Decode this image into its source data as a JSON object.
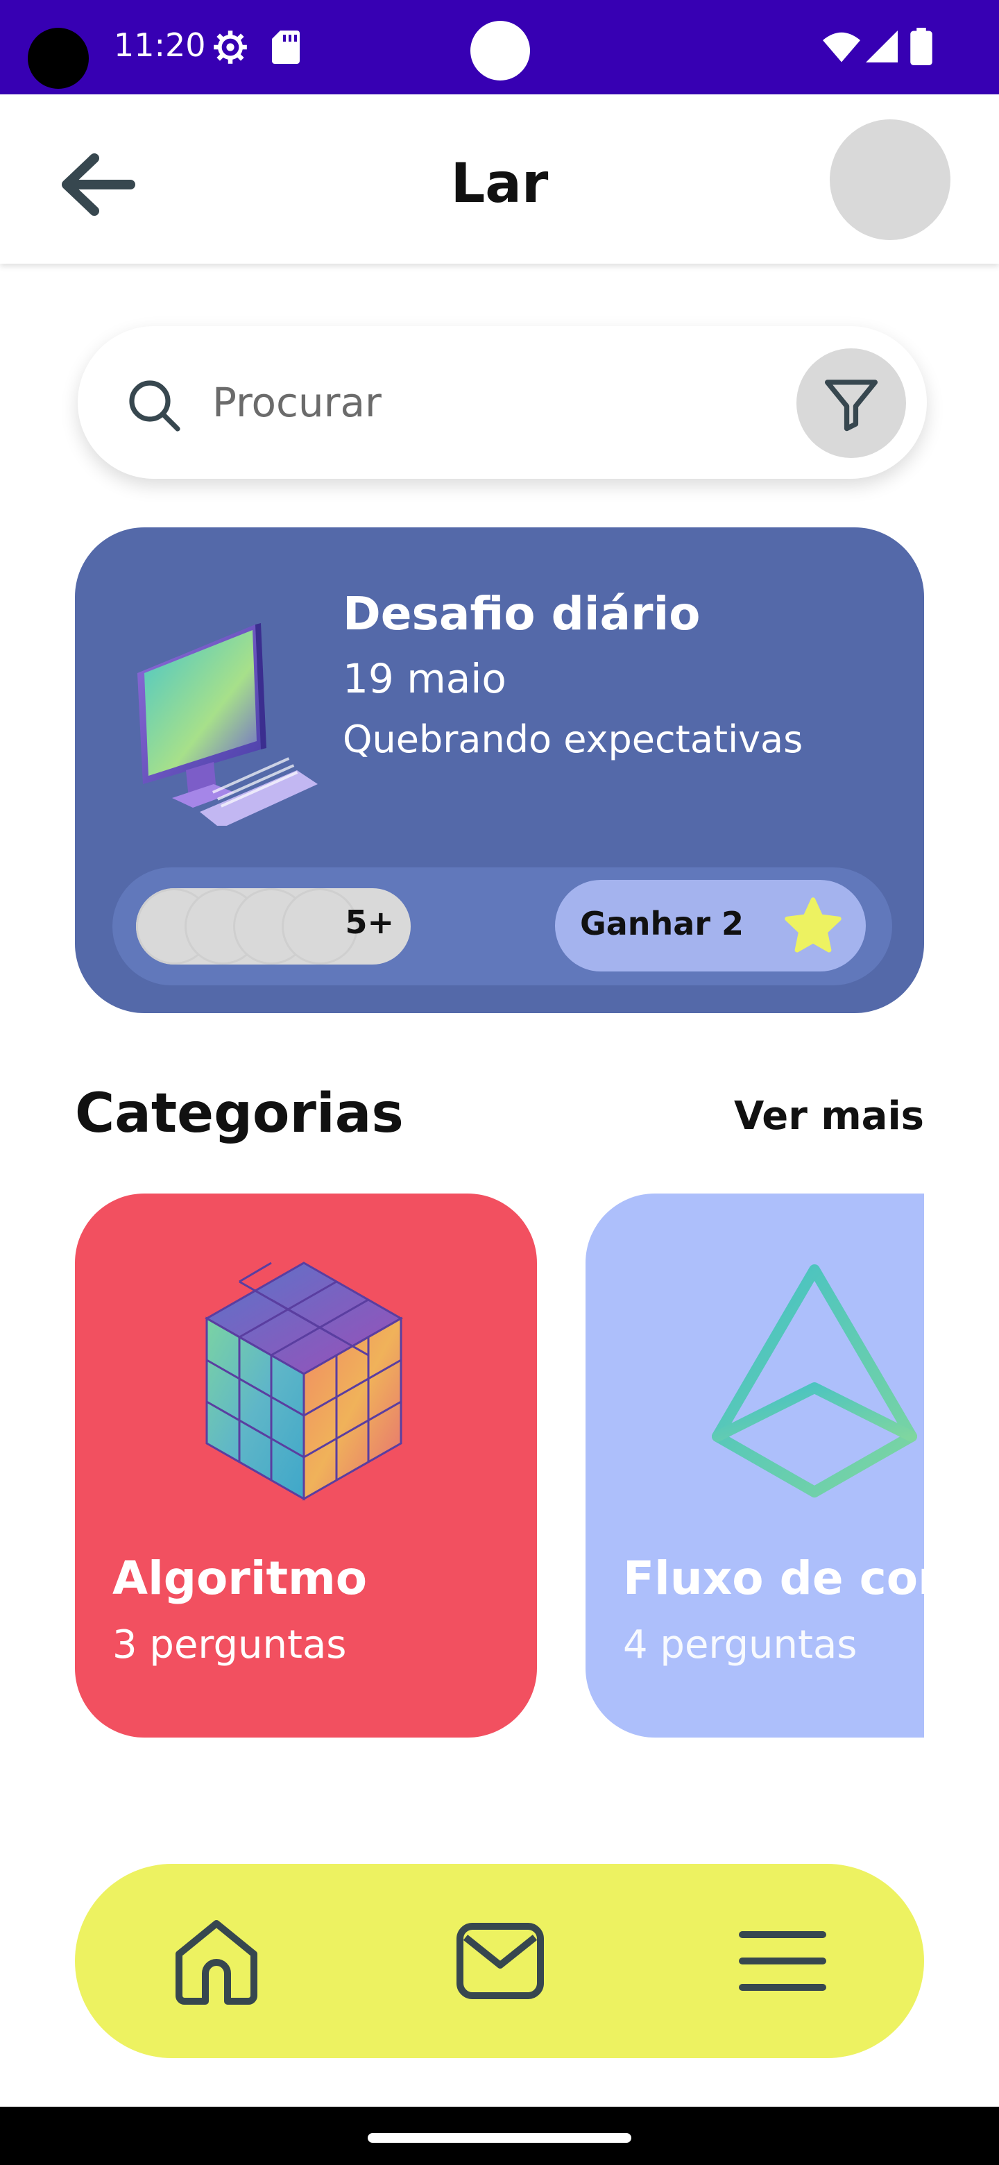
{
  "status_bar": {
    "time": "11:20",
    "icons": [
      "gear-icon",
      "sd-card-icon",
      "wifi-icon",
      "signal-icon",
      "battery-icon"
    ],
    "background": "#3700b3"
  },
  "header": {
    "title": "Lar",
    "back_icon": "arrow-left-icon"
  },
  "search": {
    "placeholder": "Procurar",
    "value": "",
    "icon": "search-icon",
    "filter_icon": "filter-icon"
  },
  "daily_challenge": {
    "title": "Desafio diário",
    "date": "19 maio",
    "subtitle": "Quebrando expectativas",
    "participants_more": "5+",
    "reward_label": "Ganhar 2",
    "reward_icon": "star-icon",
    "background": "#5469a9"
  },
  "categories": {
    "title": "Categorias",
    "see_more": "Ver mais",
    "items": [
      {
        "name": "Algoritmo",
        "count": "3 perguntas",
        "color": "#f25060",
        "icon": "cube-icon"
      },
      {
        "name": "Fluxo de controle",
        "count": "4 perguntas",
        "color": "#adbffb",
        "icon": "pyramid-icon"
      }
    ]
  },
  "bottom_nav": {
    "items": [
      "home-icon",
      "mail-icon",
      "menu-icon"
    ],
    "background": "#edf261"
  }
}
